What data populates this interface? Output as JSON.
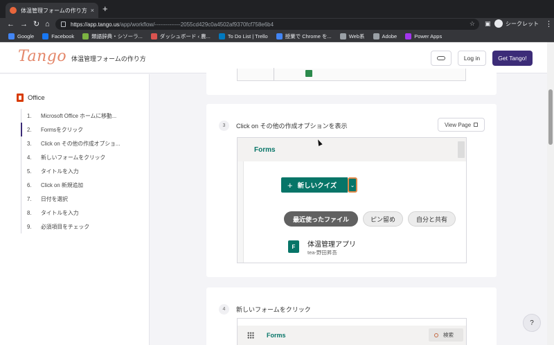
{
  "browser": {
    "tab_title": "体温管理フォームの作り方",
    "tab_close": "×",
    "new_tab": "+",
    "nav": {
      "back": "←",
      "forward": "→",
      "reload": "↻",
      "home": "⌂"
    },
    "url_host": "https://app.tango.us",
    "url_path": "/app/workflow/--------------2055cd429c0a4502af9370fcf758e6b4",
    "star": "☆",
    "profile_label": "シークレット",
    "menu": "⋮",
    "icons": [
      "star-icon",
      "sidebar-icon",
      "incognito-icon",
      "menu-icon"
    ],
    "bookmarks": [
      {
        "label": "Google",
        "icon": "google-icon",
        "color": "#4285f4"
      },
      {
        "label": "Facebook",
        "icon": "facebook-icon",
        "color": "#1877f2"
      },
      {
        "label": "類語辞典・シソーラ...",
        "icon": "weblio-icon",
        "color": "#7cb342"
      },
      {
        "label": "ダッシュボード ‹ 農...",
        "icon": "wordpress-icon",
        "color": "#d9534f"
      },
      {
        "label": "To Do List | Trello",
        "icon": "trello-icon",
        "color": "#0079bf"
      },
      {
        "label": "授業で Chrome を...",
        "icon": "google-icon",
        "color": "#4285f4"
      },
      {
        "label": "Web系",
        "icon": "folder-icon",
        "color": "#9aa0a6"
      },
      {
        "label": "Adobe",
        "icon": "folder-icon",
        "color": "#9aa0a6"
      },
      {
        "label": "Power Apps",
        "icon": "powerapps-icon",
        "color": "#a335ee"
      }
    ]
  },
  "header": {
    "logo": "Tango",
    "title": "体温管理フォームの作り方",
    "login_label": "Log in",
    "cta_label": "Get Tango!",
    "cta_color": "#3c2c78"
  },
  "sidebar": {
    "title": "Office",
    "items": [
      {
        "num": "1.",
        "label": "Microsoft Office ホームに移動..."
      },
      {
        "num": "2.",
        "label": "Formsをクリック"
      },
      {
        "num": "3.",
        "label": "Click on その他の作成オプショ..."
      },
      {
        "num": "4.",
        "label": "新しいフォームをクリック"
      },
      {
        "num": "5.",
        "label": "タイトルを入力"
      },
      {
        "num": "6.",
        "label": "Click on 新規追加"
      },
      {
        "num": "7.",
        "label": "日付を選択"
      },
      {
        "num": "8.",
        "label": "タイトルを入力"
      },
      {
        "num": "9.",
        "label": "必須項目をチェック"
      }
    ],
    "active_index": 1
  },
  "steps": [
    {
      "number": "3",
      "text": "Click on その他の作成オプションを表示",
      "view_label": "View Page",
      "screenshot": {
        "app_title": "Forms",
        "new_quiz_plus": "+",
        "new_quiz": "新しいクイズ",
        "dropdown": "⌄",
        "filters": [
          "最近使ったファイル",
          "ピン留め",
          "自分と共有"
        ],
        "file_icon_letter": "F",
        "file_name": "体温管理アプリ",
        "file_owner": "tea-野田昇吾",
        "accent": "#077568",
        "highlight": "#e08a4a"
      }
    },
    {
      "number": "4",
      "text": "新しいフォームをクリック",
      "screenshot": {
        "app_title": "Forms",
        "search_label": "検索"
      }
    }
  ],
  "help_label": "?"
}
